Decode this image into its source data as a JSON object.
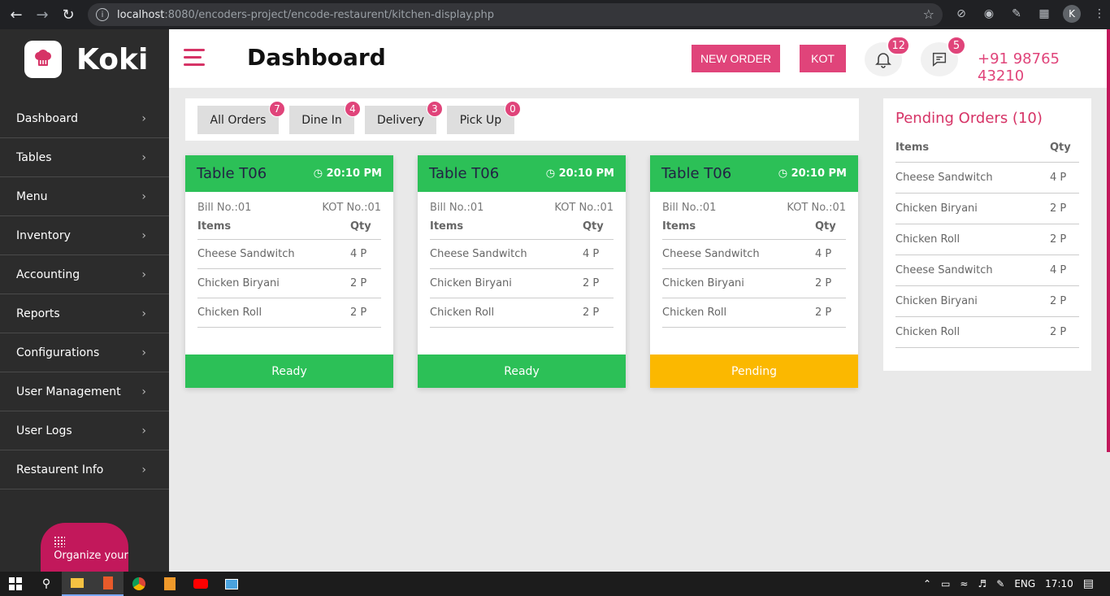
{
  "browser": {
    "url_host": "localhost",
    "url_rest": ":8080/encoders-project/encode-restaurent/kitchen-display.php",
    "profile_initial": "K"
  },
  "sidebar": {
    "brand": "Koki",
    "items": [
      {
        "label": "Dashboard"
      },
      {
        "label": "Tables"
      },
      {
        "label": "Menu"
      },
      {
        "label": "Inventory"
      },
      {
        "label": "Accounting"
      },
      {
        "label": "Reports"
      },
      {
        "label": "Configurations"
      },
      {
        "label": "User Management"
      },
      {
        "label": "User Logs"
      },
      {
        "label": "Restaurent Info"
      }
    ],
    "organize_label": "Organize your"
  },
  "header": {
    "title": "Dashboard",
    "new_order_label": "NEW ORDER",
    "kot_label": "KOT",
    "notifications_count": "12",
    "messages_count": "5",
    "phone": "+91 98765 43210"
  },
  "filters": [
    {
      "label": "All Orders",
      "count": "7"
    },
    {
      "label": "Dine In",
      "count": "4"
    },
    {
      "label": "Delivery",
      "count": "3"
    },
    {
      "label": "Pick Up",
      "count": "0"
    }
  ],
  "cards": [
    {
      "table": "Table T06",
      "time": "20:10 PM",
      "bill": "Bill No.:01",
      "kot": "KOT No.:01",
      "items_header": "Items",
      "qty_header": "Qty",
      "items": [
        {
          "name": "Cheese Sandwitch",
          "qty": "4 P"
        },
        {
          "name": "Chicken Biryani",
          "qty": "2 P"
        },
        {
          "name": "Chicken Roll",
          "qty": "2 P"
        }
      ],
      "status": "Ready",
      "status_color": "#2cc057"
    },
    {
      "table": "Table T06",
      "time": "20:10 PM",
      "bill": "Bill No.:01",
      "kot": "KOT No.:01",
      "items_header": "Items",
      "qty_header": "Qty",
      "items": [
        {
          "name": "Cheese Sandwitch",
          "qty": "4 P"
        },
        {
          "name": "Chicken Biryani",
          "qty": "2 P"
        },
        {
          "name": "Chicken Roll",
          "qty": "2 P"
        }
      ],
      "status": "Ready",
      "status_color": "#2cc057"
    },
    {
      "table": "Table T06",
      "time": "20:10 PM",
      "bill": "Bill No.:01",
      "kot": "KOT No.:01",
      "items_header": "Items",
      "qty_header": "Qty",
      "items": [
        {
          "name": "Cheese Sandwitch",
          "qty": "4 P"
        },
        {
          "name": "Chicken Biryani",
          "qty": "2 P"
        },
        {
          "name": "Chicken Roll",
          "qty": "2 P"
        }
      ],
      "status": "Pending",
      "status_color": "#fbb800"
    }
  ],
  "pending": {
    "title": "Pending Orders (10)",
    "items_header": "Items",
    "qty_header": "Qty",
    "rows": [
      {
        "name": "Cheese Sandwitch",
        "qty": "4 P"
      },
      {
        "name": "Chicken Biryani",
        "qty": "2 P"
      },
      {
        "name": "Chicken Roll",
        "qty": "2 P"
      },
      {
        "name": "Cheese Sandwitch",
        "qty": "4 P"
      },
      {
        "name": "Chicken Biryani",
        "qty": "2 P"
      },
      {
        "name": "Chicken Roll",
        "qty": "2 P"
      }
    ]
  },
  "taskbar": {
    "language": "ENG",
    "time": "17:10"
  },
  "colors": {
    "accent": "#e0447a",
    "ready": "#2cc057",
    "pending": "#fbb800",
    "sidebar": "#2c2c2c"
  }
}
